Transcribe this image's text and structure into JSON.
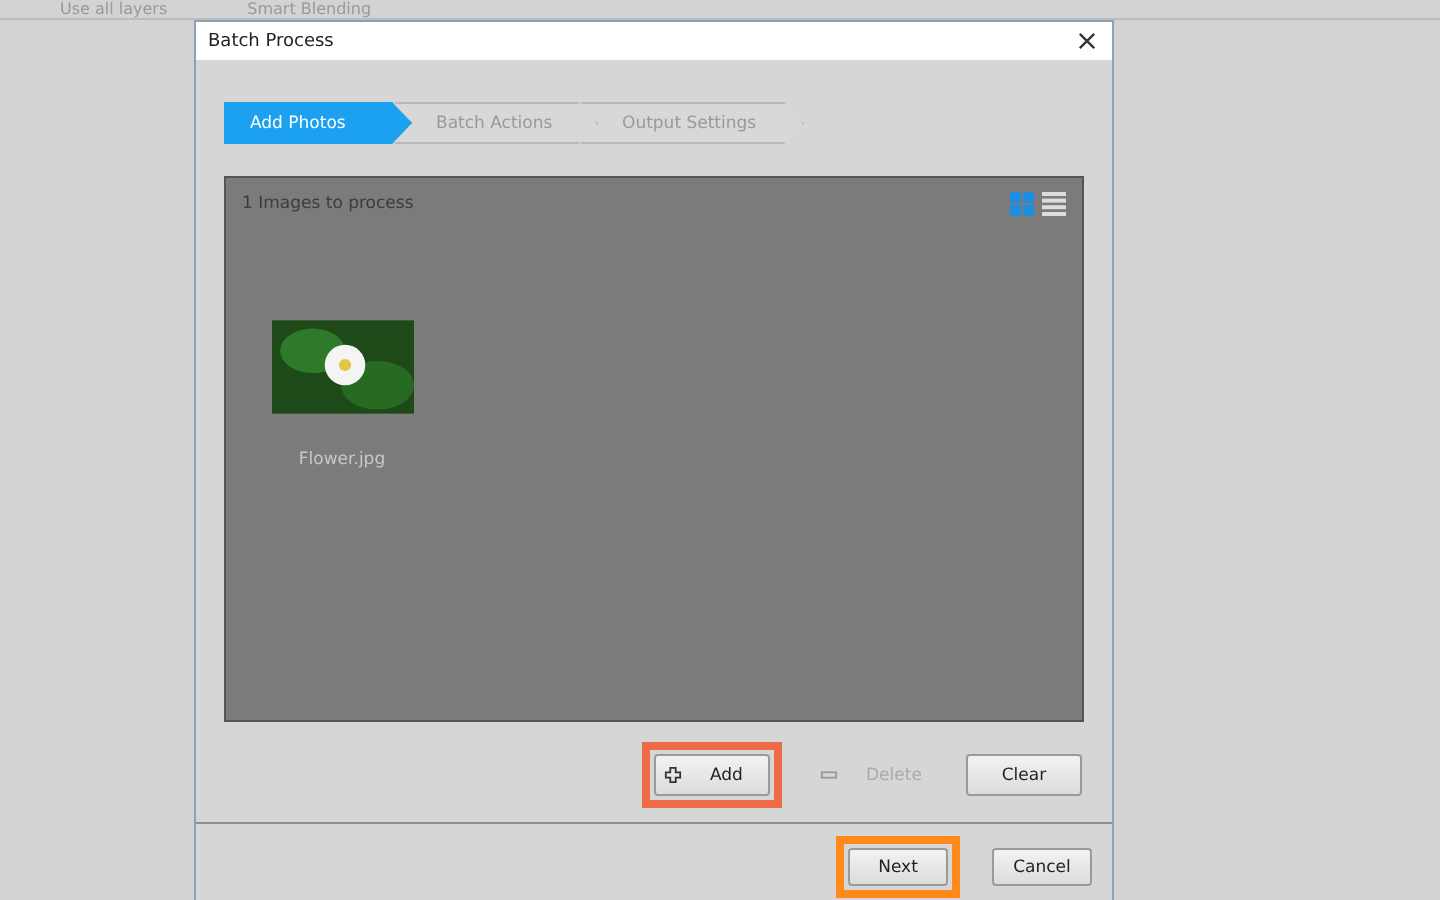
{
  "background_toolbar": {
    "items": [
      {
        "label": "Use all layers"
      },
      {
        "label": "Smart Blending"
      }
    ]
  },
  "window": {
    "title": "Batch Process"
  },
  "steps": [
    {
      "label": "Add Photos",
      "selected": true
    },
    {
      "label": "Batch Actions",
      "selected": false
    },
    {
      "label": "Output Settings",
      "selected": false
    }
  ],
  "panel": {
    "count_text": "1 Images to process",
    "views": [
      {
        "kind": "grid",
        "selected": true
      },
      {
        "kind": "list",
        "selected": false
      }
    ],
    "images": [
      {
        "name": "Flower.jpg"
      }
    ]
  },
  "actions": [
    {
      "kind": "add",
      "label": "Add",
      "disabled": false,
      "highlighted": true
    },
    {
      "kind": "delete",
      "label": "Delete",
      "disabled": true,
      "highlighted": false
    },
    {
      "kind": "clear",
      "label": "Clear",
      "disabled": false,
      "highlighted": false
    }
  ],
  "footer": [
    {
      "label": "Next",
      "highlighted": true
    },
    {
      "label": "Cancel",
      "highlighted": false
    }
  ]
}
